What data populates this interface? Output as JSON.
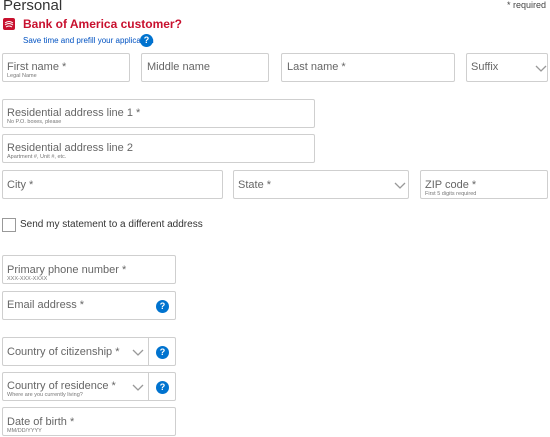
{
  "header": {
    "title": "Personal",
    "required_note": "* required"
  },
  "prefill": {
    "question": "Bank of America customer?",
    "link": "Save time and prefill your application",
    "help_icon": "?"
  },
  "name": {
    "first_label": "First name *",
    "first_hint": "Legal Name",
    "middle_label": "Middle name",
    "last_label": "Last name *",
    "suffix_label": "Suffix"
  },
  "address": {
    "line1_label": "Residential address line 1 *",
    "line1_hint": "No P.O. boxes, please",
    "line2_label": "Residential address line 2",
    "line2_hint": "Apartment #, Unit #, etc.",
    "city_label": "City *",
    "state_label": "State *",
    "zip_label": "ZIP code *",
    "zip_hint": "First 5 digits required"
  },
  "statement_checkbox_label": "Send my statement to a different address",
  "contact": {
    "phone_label": "Primary phone number *",
    "phone_hint": "XXX-XXX-XXXX",
    "email_label": "Email address *"
  },
  "citizenship": {
    "country_label": "Country of citizenship *",
    "residence_label": "Country of residence *",
    "residence_hint": "Where are you currently living?"
  },
  "dob": {
    "label": "Date of birth *",
    "hint": "MM/DD/YYYY"
  },
  "colors": {
    "brand_red": "#c8102e",
    "link_blue": "#0052c2",
    "help_blue": "#0073cf",
    "field_border": "#cfcfcf"
  },
  "icons": [
    "bank-logo-icon",
    "help-icon",
    "chevron-down-icon"
  ]
}
